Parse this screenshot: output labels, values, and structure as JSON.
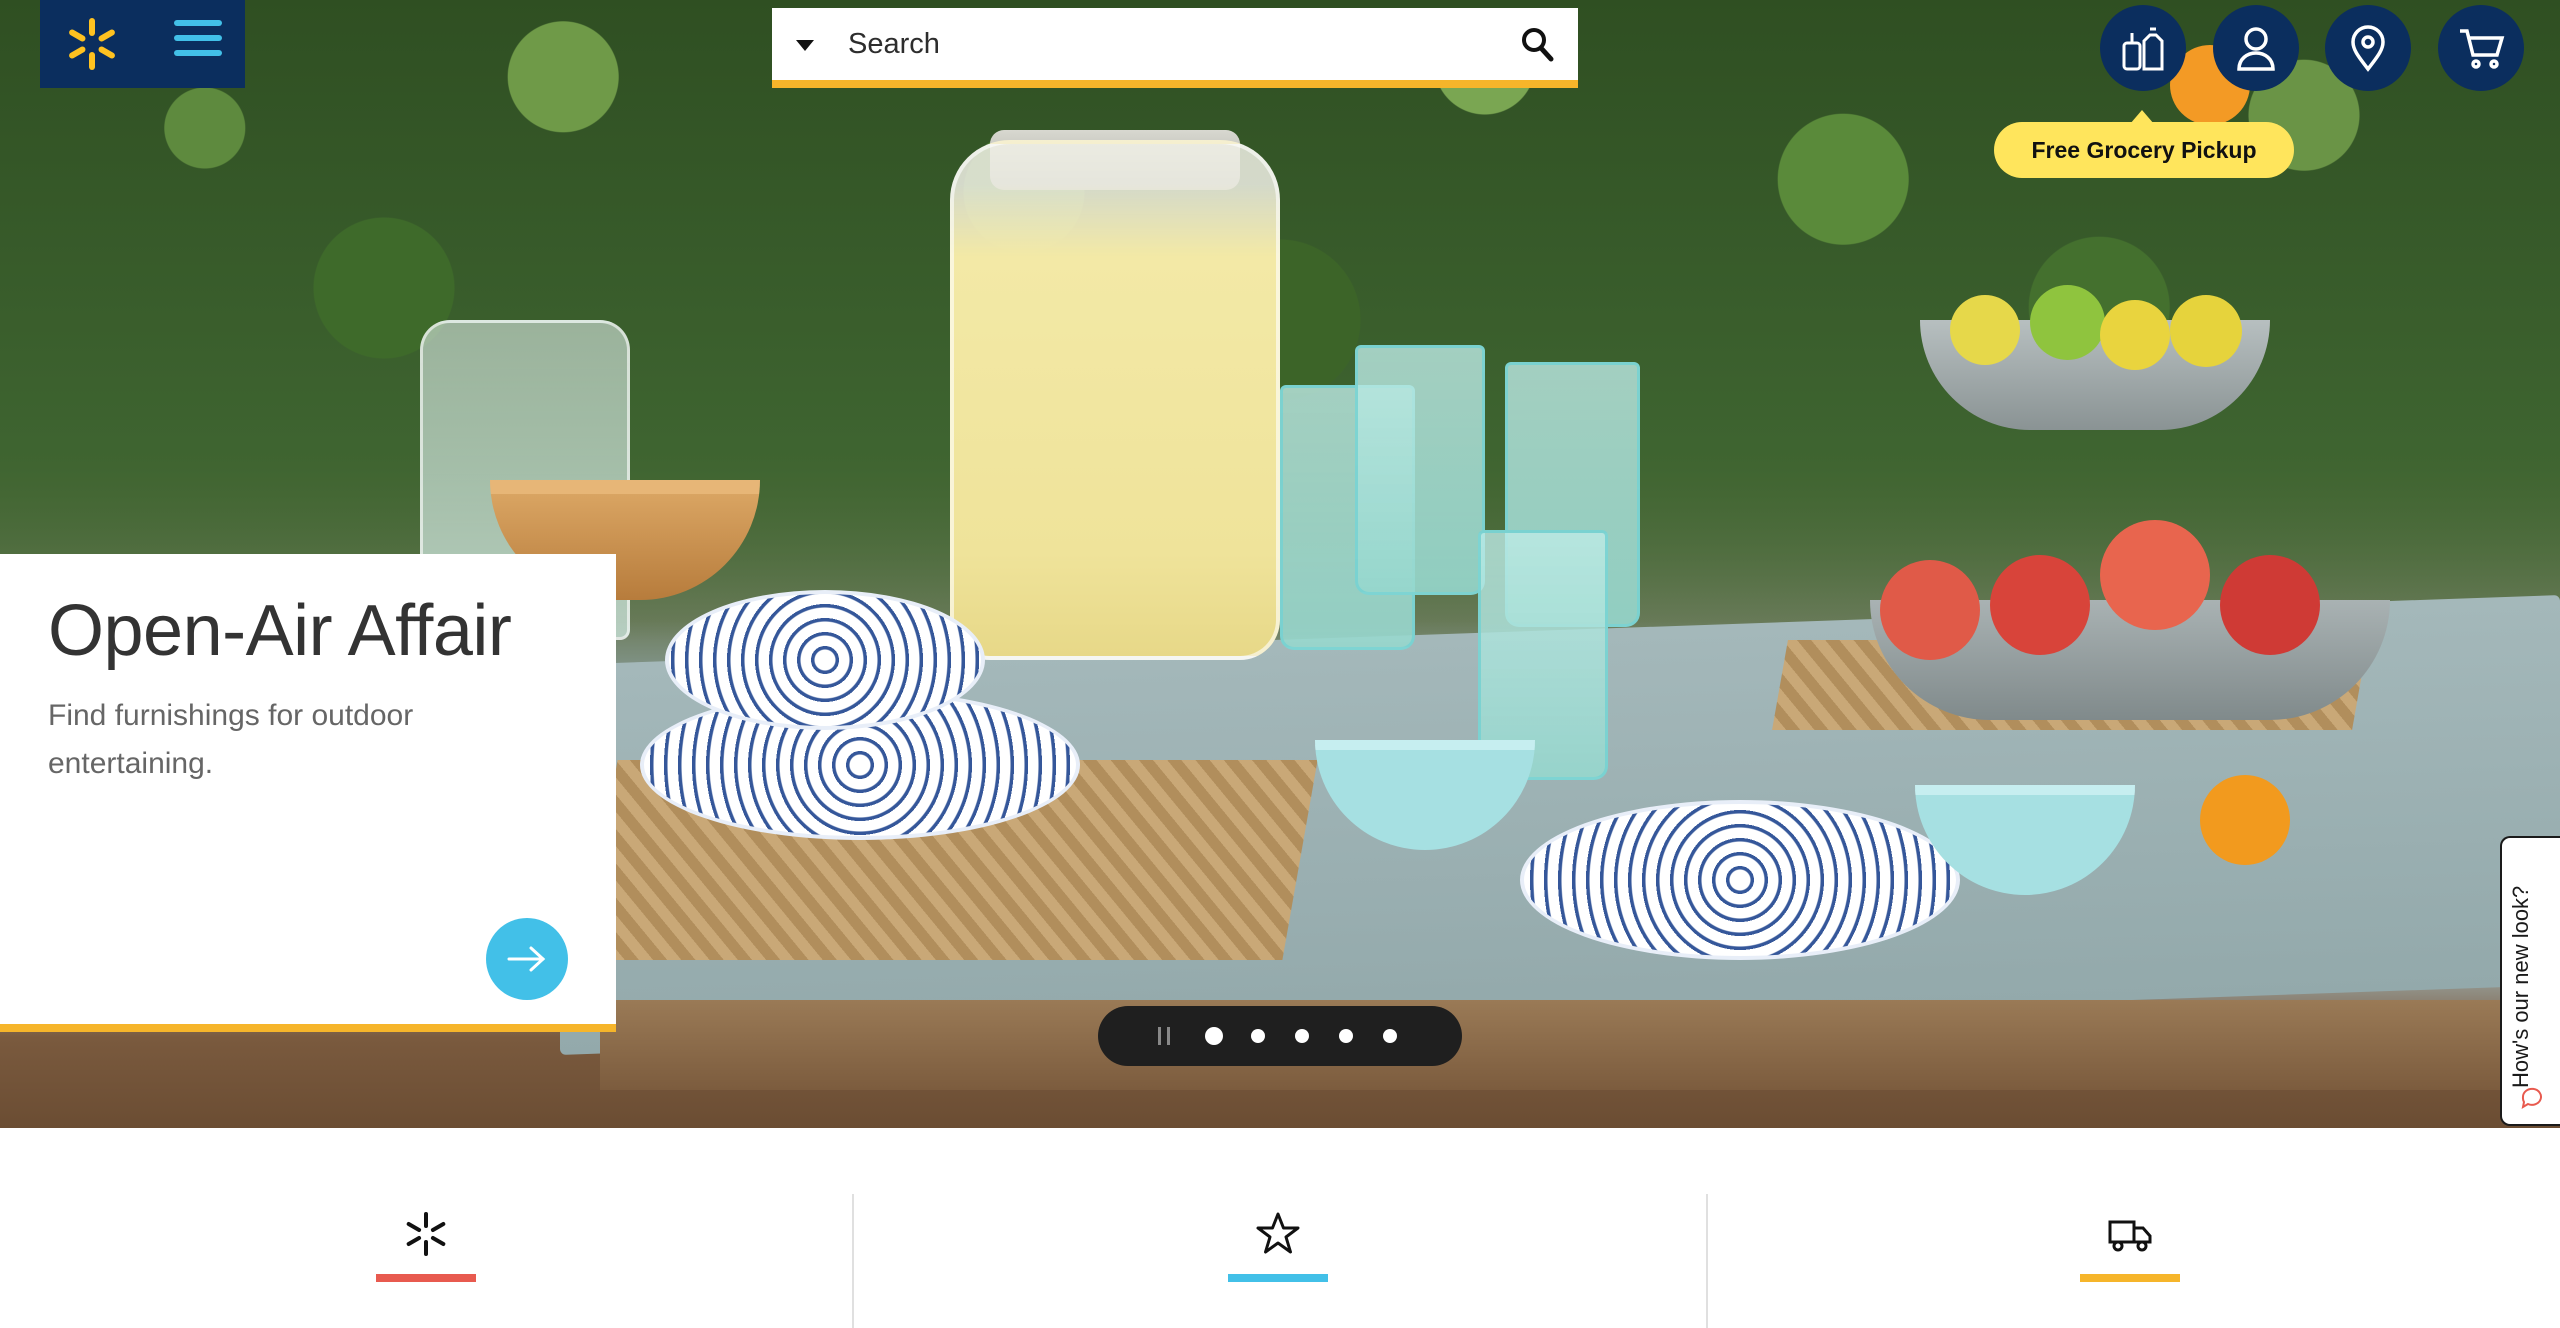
{
  "header": {
    "search_placeholder": "Search",
    "pickup_label": "Free Grocery Pickup",
    "icons": [
      "grocery-icon",
      "account-icon",
      "location-icon",
      "cart-icon"
    ]
  },
  "hero": {
    "title": "Open-Air Affair",
    "subtitle": "Find furnishings for outdoor entertaining.",
    "carousel": {
      "slides": 5,
      "active": 1
    }
  },
  "feedback": {
    "label": "How's our new look?"
  },
  "features": [
    {
      "icon": "spark-icon",
      "accent": "#e85a4f"
    },
    {
      "icon": "star-icon",
      "accent": "#42c0e8"
    },
    {
      "icon": "truck-icon",
      "accent": "#f6b52a"
    }
  ],
  "colors": {
    "brand_blue": "#0b2e5e",
    "spark_yellow": "#ffc220",
    "accent_blue": "#42c0e8",
    "accent_yellow": "#f6b52a"
  }
}
